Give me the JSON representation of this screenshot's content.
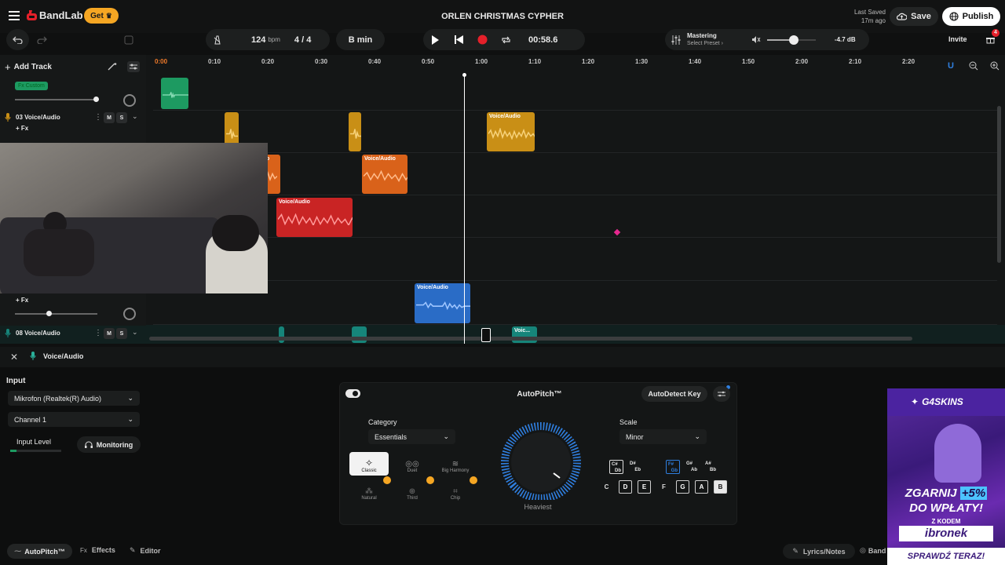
{
  "app": {
    "name": "BandLab",
    "get_label": "Get",
    "project_title": "ORLEN CHRISTMAS CYPHER",
    "last_saved_label": "Last Saved",
    "last_saved_time": "17m ago",
    "save_label": "Save",
    "publish_label": "Publish"
  },
  "toolbar": {
    "bpm_value": "124",
    "bpm_unit": "bpm",
    "time_signature": "4 / 4",
    "key": "B min",
    "position": "00:58.6",
    "mastering_label": "Mastering",
    "mastering_sub": "Select Preset",
    "volume_db": "-4.7 dB",
    "invite_label": "Invite",
    "notification_count": "4"
  },
  "tracks": {
    "add_track_label": "Add Track",
    "fx_custom": "Fx Custom",
    "track3_name": "03  Voice/Audio",
    "track3_fx": "+ Fx",
    "track7_fx": "+ Fx",
    "track8_name": "08  Voice/Audio",
    "mute": "M",
    "solo": "S"
  },
  "ruler": [
    "0:00",
    "0:10",
    "0:20",
    "0:30",
    "0:40",
    "0:50",
    "1:00",
    "1:10",
    "1:20",
    "1:30",
    "1:40",
    "1:50",
    "2:00",
    "2:10",
    "2:20"
  ],
  "clips": {
    "c1": "Voice/Audio",
    "c2": "Voice/Audio",
    "c3": "Voice/Audio",
    "c4": "Voice/Audio",
    "c5": "Voic...",
    "c6": "o"
  },
  "panel": {
    "track_label": "Voice/Audio",
    "input_heading": "Input",
    "input_device": "Mikrofon (Realtek(R) Audio)",
    "channel": "Channel 1",
    "input_level_label": "Input Level",
    "monitoring_label": "Monitoring"
  },
  "autopitch": {
    "title": "AutoPitch™",
    "autodetect_label": "AutoDetect Key",
    "category_label": "Category",
    "category_value": "Essentials",
    "scale_label": "Scale",
    "scale_value": "Minor",
    "knob_label": "Heaviest",
    "presets": [
      "Classic",
      "Duet",
      "Big Harmony",
      "Natural",
      "Third",
      "Chip"
    ],
    "keys_top": [
      {
        "t": "C#",
        "b": "Db"
      },
      {
        "t": "D#",
        "b": "Eb"
      },
      {
        "t": "F#",
        "b": "Gb"
      },
      {
        "t": "G#",
        "b": "Ab"
      },
      {
        "t": "A#",
        "b": "Bb"
      }
    ],
    "keys_bottom": [
      "C",
      "D",
      "E",
      "F",
      "G",
      "A",
      "B"
    ]
  },
  "bottom_tabs": {
    "autopitch": "AutoPitch™",
    "effects": "Effects",
    "effects_prefix": "Fx",
    "editor": "Editor",
    "lyrics": "Lyrics/Notes",
    "band": "Band"
  },
  "ad": {
    "brand": "G4SKINS",
    "line1": "ZGARNIJ",
    "bonus": "+5%",
    "line2": "DO WPŁATY!",
    "code_label": "Z KODEM",
    "code": "ibronek",
    "cta": "SPRAWDŹ TERAZ!"
  },
  "colors": {
    "accent_blue": "#2f7fe0",
    "record": "#e5202a",
    "get_pill": "#f5a623",
    "green_clip": "#1d9a61",
    "yellow_clip": "#c98f16",
    "orange_clip": "#d9621a",
    "red_clip": "#c92424",
    "blue_clip": "#2a6cc6",
    "teal_clip": "#16857a"
  }
}
